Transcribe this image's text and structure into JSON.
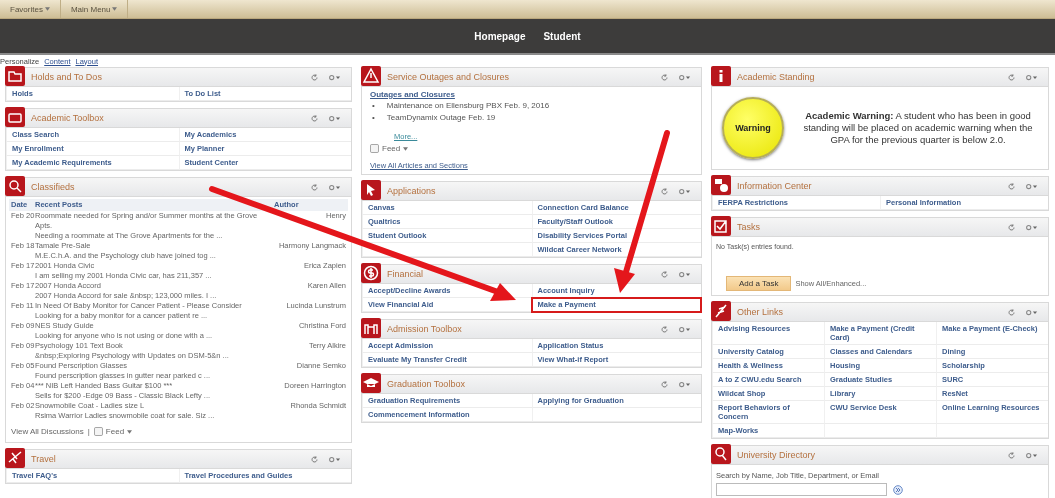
{
  "menu_bar": {
    "items": [
      "Favorites",
      "Main Menu"
    ]
  },
  "header": {
    "title": "Homepage",
    "subtitle": "Student"
  },
  "personalize": {
    "label": "Personalize",
    "links": [
      "Content",
      "Layout"
    ]
  },
  "columns": [
    [
      {
        "kind": "links",
        "title": "Holds and To Dos",
        "rows": [
          [
            "Holds",
            "To Do List"
          ]
        ]
      },
      {
        "kind": "links",
        "title": "Academic Toolbox",
        "rows": [
          [
            "Class Search",
            "My Academics"
          ],
          [
            "My Enrollment",
            "My Planner"
          ],
          [
            "My Academic Requirements",
            "Student Center"
          ]
        ]
      },
      {
        "kind": "classifieds",
        "title": "Classifieds",
        "columns": [
          "Date",
          "Recent Posts",
          "Author"
        ],
        "rows": [
          {
            "date": "Feb 20",
            "title": "Roommate needed for Spring and/or Summer months at the Grove Apts.",
            "snippet": "Needing a roommate at The Grove Apartments for the ...",
            "author": "Henry"
          },
          {
            "date": "Feb 18",
            "title": "Tamale Pre-Sale",
            "snippet": "M.E.C.h.A. and the Psychology club have joined tog ...",
            "author": "Harmony Langmack"
          },
          {
            "date": "Feb 17",
            "title": "2001 Honda Civic",
            "snippet": "I am selling my 2001 Honda Civic car, has 211,357 ...",
            "author": "Erica Zapien"
          },
          {
            "date": "Feb 17",
            "title": "2007 Honda Accord",
            "snippet": "2007 Honda Accord for sale &nbsp; 123,000 miles. I ...",
            "author": "Karen Allen"
          },
          {
            "date": "Feb 11",
            "title": "In Need Of Baby Monitor for Cancer Patient - Please Consider",
            "snippet": "Looking for a baby monitor for a cancer patient re ...",
            "author": "Lucinda Lunstrum"
          },
          {
            "date": "Feb 09",
            "title": "NES Study Guide",
            "snippet": "Looking for anyone who is not using or done with a ...",
            "author": "Christina Ford"
          },
          {
            "date": "Feb 09",
            "title": "Psychology 101 Text Book",
            "snippet": "&nbsp;Exploring Psychology with Updates on DSM-5&n ...",
            "author": "Terry Alkire"
          },
          {
            "date": "Feb 05",
            "title": "Found Perscription Glasses",
            "snippet": "Found perscription glasses in gutter near parked c ...",
            "author": "Dianne Semko"
          },
          {
            "date": "Feb 04",
            "title": "*** NIB Left Handed Bass Guitar $100 ***",
            "snippet": "Sells for $200 -Edge 09 Bass - Classic Black Lefty ...",
            "author": "Doreen Harrington"
          },
          {
            "date": "Feb 02",
            "title": "Snowmobile Coat - Ladies size L",
            "snippet": "Rsima Warrior Ladies snowmobile coat for sale. Siz ...",
            "author": "Rhonda Schmidt"
          }
        ],
        "footer_link": "View All Discussions",
        "separator": "|",
        "feed": "Feed"
      },
      {
        "kind": "links",
        "title": "Travel",
        "rows": [
          [
            "Travel FAQ's",
            "Travel Procedures and Guides"
          ]
        ]
      }
    ],
    [
      {
        "kind": "outages",
        "title": "Service Outages and Closures",
        "link": "Outages and Closures",
        "items": [
          {
            "marker": "•",
            "text": "Maintenance on Ellensburg PBX Feb. 9, 2016"
          },
          {
            "marker": "•",
            "text": "TeamDynamix Outage Feb. 19"
          }
        ],
        "more": "More...",
        "feed": "Feed",
        "footer_link": "View All Articles and Sections"
      },
      {
        "kind": "links",
        "title": "Applications",
        "rows": [
          [
            "Canvas",
            "Connection Card Balance"
          ],
          [
            "Qualtrics",
            "Faculty/Staff Outlook"
          ],
          [
            "Student Outlook",
            "Disability Services Portal"
          ],
          [
            null,
            "Wildcat Career Network"
          ]
        ]
      },
      {
        "kind": "links",
        "title": "Financial",
        "rows": [
          [
            {
              "text": "Accept/Decline Awards",
              "highlighted": false
            },
            {
              "text": "Account Inquiry",
              "highlighted": false
            }
          ],
          [
            {
              "text": "View Financial Aid",
              "highlighted": false
            },
            {
              "text": "Make a Payment",
              "highlighted": true
            }
          ]
        ]
      },
      {
        "kind": "links",
        "title": "Admission Toolbox",
        "rows": [
          [
            "Accept Admission",
            "Application Status"
          ],
          [
            "Evaluate My Transfer Credit",
            "View What-if Report"
          ]
        ]
      },
      {
        "kind": "links",
        "title": "Graduation Toolbox",
        "rows": [
          [
            "Graduation Requirements",
            "Applying for Graduation"
          ],
          [
            "Commencement Information"
          ]
        ]
      }
    ],
    [
      {
        "kind": "standing",
        "title": "Academic Standing",
        "badge": "Warning",
        "message": "**Academic Warning:** A student who has been in good standing will be placed on academic warning when the GPA for the previous quarter is below 2.0."
      },
      {
        "kind": "links",
        "title": "Information Center",
        "rows": [
          [
            "FERPA Restrictions",
            "Personal Information"
          ]
        ]
      },
      {
        "kind": "tasks",
        "title": "Tasks",
        "empty_text": "No Task(s) entries found.",
        "button": "Add a Task",
        "link": "Show All/Enhanced..."
      },
      {
        "kind": "links",
        "title": "Other Links",
        "rows": [
          [
            "Advising Resources",
            "Make a Payment (Credit Card)",
            "Make a Payment (E-Check)"
          ],
          [
            "University Catalog",
            "Classes and Calendars",
            "Dining"
          ],
          [
            "Health & Wellness",
            "Housing",
            "Scholarship"
          ],
          [
            "A to Z CWU.edu Search",
            "Graduate Studies",
            "SURC"
          ],
          [
            "Wildcat Shop",
            "Library",
            "ResNet"
          ],
          [
            "Report Behaviors of Concern",
            "CWU Service Desk",
            "Online Learning Resources"
          ],
          [
            "Map-Works"
          ]
        ]
      },
      {
        "kind": "directory",
        "title": "University Directory",
        "label": "Search by Name, Job Title, Department, or Email"
      }
    ]
  ]
}
